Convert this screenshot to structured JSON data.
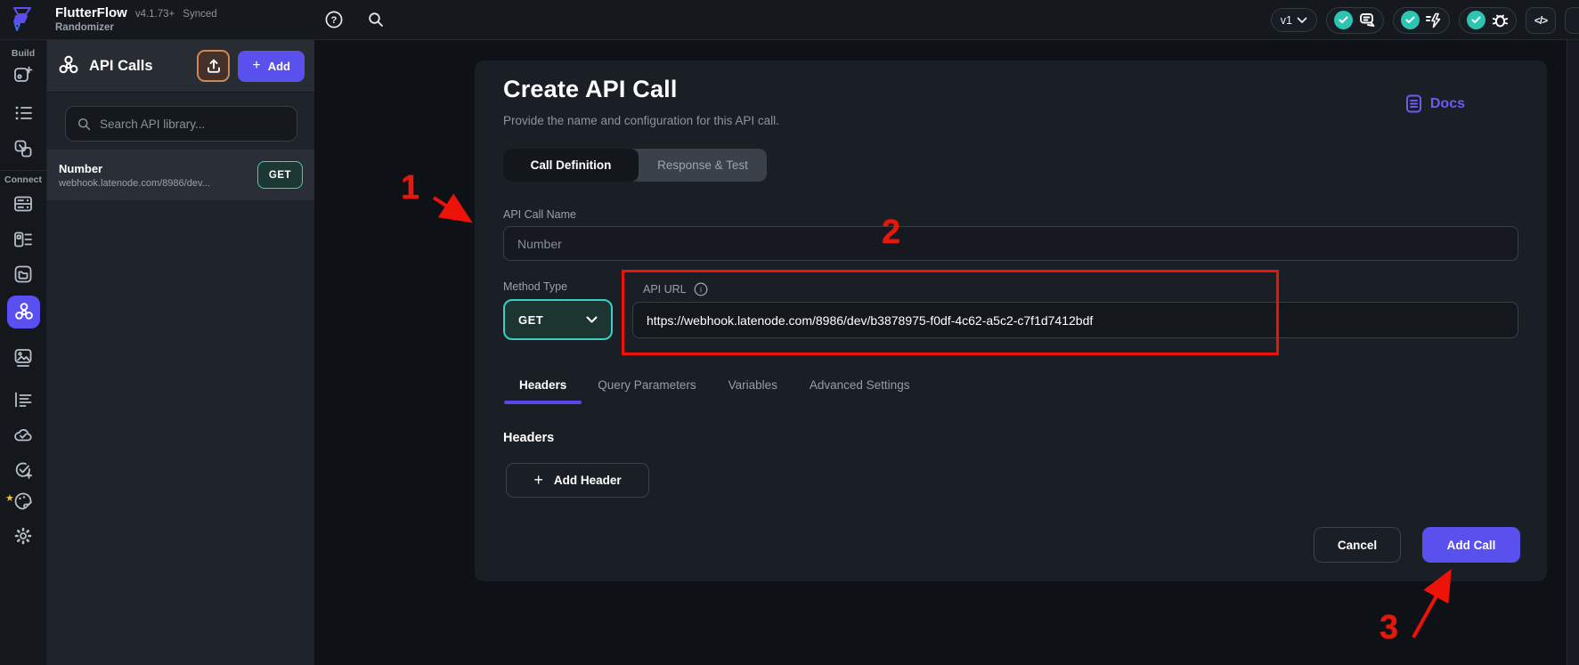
{
  "topbar": {
    "app_name": "FlutterFlow",
    "version": "v4.1.73+",
    "sync_status": "Synced",
    "project_name": "Randomizer",
    "branch_label": "v1"
  },
  "sidebar": {
    "build_label": "Build",
    "connect_label": "Connect"
  },
  "api_panel": {
    "title": "API Calls",
    "add_label": "Add",
    "search_placeholder": "Search API library...",
    "items": [
      {
        "name": "Number",
        "url": "webhook.latenode.com/8986/dev...",
        "method": "GET"
      }
    ]
  },
  "dialog": {
    "title": "Create API Call",
    "subtitle": "Provide the name and configuration for this API call.",
    "docs_label": "Docs",
    "tabs": [
      "Call Definition",
      "Response & Test"
    ],
    "name_label": "API Call Name",
    "name_placeholder": "Number",
    "method_label": "Method Type",
    "method_value": "GET",
    "url_label": "API URL",
    "url_value": "https://webhook.latenode.com/8986/dev/b3878975-f0df-4c62-a5c2-c7f1d7412bdf",
    "section_tabs": [
      "Headers",
      "Query Parameters",
      "Variables",
      "Advanced Settings"
    ],
    "headers_title": "Headers",
    "add_header_label": "Add Header",
    "cancel_label": "Cancel",
    "submit_label": "Add Call"
  },
  "annotations": {
    "step1": "1",
    "step2": "2",
    "step3": "3"
  },
  "icons": {
    "code_glyph": "</>",
    "help_glyph": "?",
    "info_glyph": "i",
    "plus_glyph": "+",
    "star_glyph": "★"
  },
  "colors": {
    "accent_purple": "#5a50ee",
    "teal": "#39d2c0",
    "annotation_red": "#ee1208",
    "upload_orange": "#cf8755",
    "panel_bg": "#1e232a",
    "dialog_bg": "#1a1f26",
    "topbar_bg": "#15181d"
  }
}
